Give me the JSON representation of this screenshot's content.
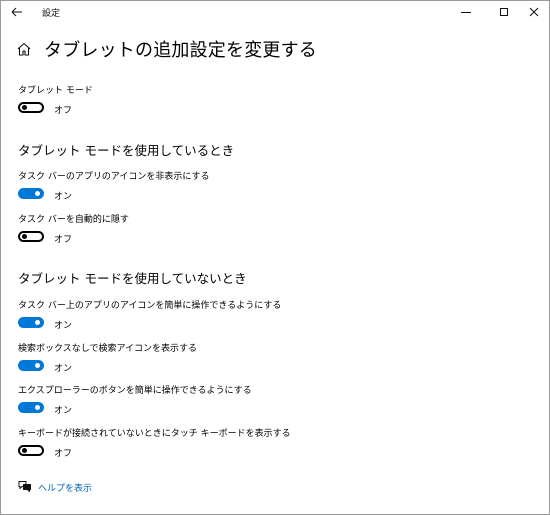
{
  "window": {
    "title": "設定",
    "back_icon": "back-arrow-icon",
    "minimize_icon": "minimize-icon",
    "maximize_icon": "maximize-icon",
    "close_icon": "close-icon"
  },
  "header": {
    "home_icon": "home-icon",
    "title": "タブレットの追加設定を変更する"
  },
  "tablet_mode": {
    "label": "タブレット モード",
    "state": "オフ",
    "on": false
  },
  "section_in_use": {
    "heading": "タブレット モードを使用しているとき",
    "settings": [
      {
        "label": "タスク バーのアプリのアイコンを非表示にする",
        "state": "オン",
        "on": true
      },
      {
        "label": "タスク バーを自動的に隠す",
        "state": "オフ",
        "on": false
      }
    ]
  },
  "section_not_in_use": {
    "heading": "タブレット モードを使用していないとき",
    "settings": [
      {
        "label": "タスク バー上のアプリのアイコンを簡単に操作できるようにする",
        "state": "オン",
        "on": true
      },
      {
        "label": "検索ボックスなしで検索アイコンを表示する",
        "state": "オン",
        "on": true
      },
      {
        "label": "エクスプローラーのボタンを簡単に操作できるようにする",
        "state": "オン",
        "on": true
      },
      {
        "label": "キーボードが接続されていないときにタッチ キーボードを表示する",
        "state": "オフ",
        "on": false
      }
    ]
  },
  "help": {
    "icon": "help-chat-icon",
    "label": "ヘルプを表示"
  },
  "colors": {
    "accent": "#0078d7",
    "link": "#0066b4"
  }
}
